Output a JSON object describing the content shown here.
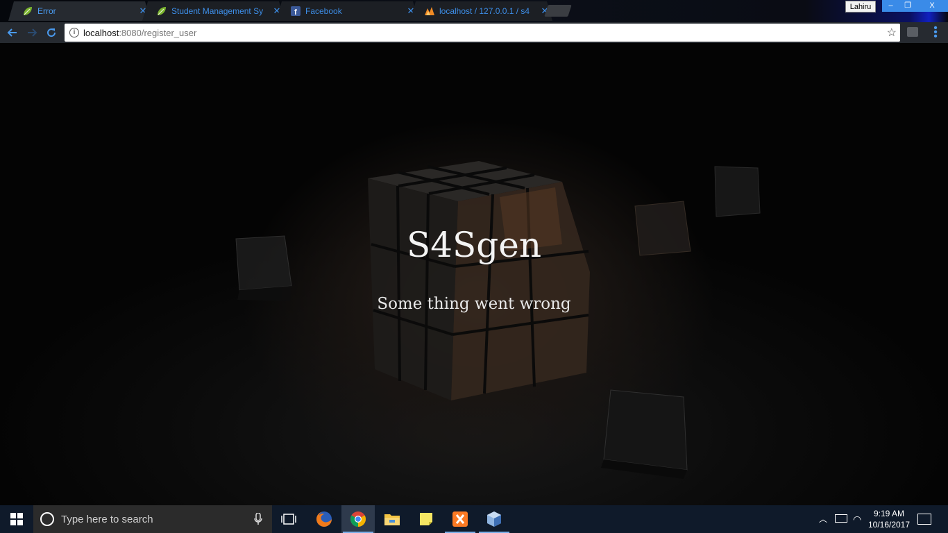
{
  "browser": {
    "tabs": [
      {
        "title": "Error",
        "favicon": "spring-leaf-icon",
        "active": true
      },
      {
        "title": "Student Management Sy",
        "favicon": "spring-leaf-icon",
        "active": false
      },
      {
        "title": "Facebook",
        "favicon": "facebook-icon",
        "active": false
      },
      {
        "title": "localhost / 127.0.0.1 / s4",
        "favicon": "phpmyadmin-icon",
        "active": false
      }
    ],
    "profile_name": "Lahiru",
    "window_controls": {
      "minimize": "–",
      "maximize": "❐",
      "close": "X"
    },
    "url_host": "localhost",
    "url_rest": ":8080/register_user",
    "accent_color": "#3d8ee8"
  },
  "page": {
    "site_title": "S4Sgen",
    "error_message": "Some thing went wrong"
  },
  "taskbar": {
    "search_placeholder": "Type here to search",
    "apps": [
      "task-view-icon",
      "firefox-icon",
      "chrome-icon",
      "file-explorer-icon",
      "sticky-notes-icon",
      "xampp-icon",
      "virtualbox-icon"
    ],
    "time": "9:19 AM",
    "date": "10/16/2017",
    "background": "#0f1a2a"
  }
}
